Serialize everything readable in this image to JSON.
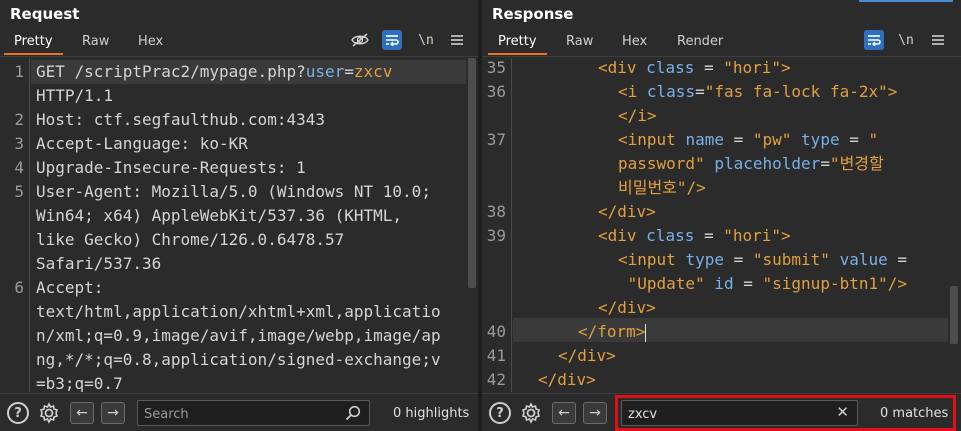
{
  "request": {
    "title": "Request",
    "tabs": [
      "Pretty",
      "Raw",
      "Hex"
    ],
    "active_tab": "Pretty",
    "toolbar_icons": [
      "eye-off-icon",
      "wrap-icon",
      "newline-icon",
      "menu-icon"
    ],
    "newline_label": "\\n",
    "lines": [
      {
        "num": "1",
        "parts": [
          [
            "txt",
            "GET /scriptPrac2/mypage.php?"
          ],
          [
            "param",
            "user"
          ],
          [
            "txt",
            "="
          ],
          [
            "pval",
            "zxcv"
          ]
        ]
      },
      {
        "num": "",
        "parts": [
          [
            "txt",
            "HTTP/1.1"
          ]
        ]
      },
      {
        "num": "2",
        "parts": [
          [
            "txt",
            "Host: ctf.segfaulthub.com:4343"
          ]
        ]
      },
      {
        "num": "3",
        "parts": [
          [
            "txt",
            "Accept-Language: ko-KR"
          ]
        ]
      },
      {
        "num": "4",
        "parts": [
          [
            "txt",
            "Upgrade-Insecure-Requests: 1"
          ]
        ]
      },
      {
        "num": "5",
        "parts": [
          [
            "txt",
            "User-Agent: Mozilla/5.0 (Windows NT 10.0;"
          ]
        ]
      },
      {
        "num": "",
        "parts": [
          [
            "txt",
            "Win64; x64) AppleWebKit/537.36 (KHTML,"
          ]
        ]
      },
      {
        "num": "",
        "parts": [
          [
            "txt",
            "like Gecko) Chrome/126.0.6478.57"
          ]
        ]
      },
      {
        "num": "",
        "parts": [
          [
            "txt",
            "Safari/537.36"
          ]
        ]
      },
      {
        "num": "6",
        "parts": [
          [
            "txt",
            "Accept:"
          ]
        ]
      },
      {
        "num": "",
        "parts": [
          [
            "txt",
            "text/html,application/xhtml+xml,applicatio"
          ]
        ]
      },
      {
        "num": "",
        "parts": [
          [
            "txt",
            "n/xml;q=0.9,image/avif,image/webp,image/ap"
          ]
        ]
      },
      {
        "num": "",
        "parts": [
          [
            "txt",
            "ng,*/*;q=0.8,application/signed-exchange;v"
          ]
        ]
      },
      {
        "num": "",
        "parts": [
          [
            "txt",
            "=b3;q=0.7"
          ]
        ]
      }
    ],
    "search": {
      "placeholder": "Search",
      "value": ""
    },
    "highlights_label": "0 highlights"
  },
  "response": {
    "title": "Response",
    "tabs": [
      "Pretty",
      "Raw",
      "Hex",
      "Render"
    ],
    "active_tab": "Pretty",
    "toolbar_icons": [
      "wrap-icon",
      "newline-icon",
      "menu-icon"
    ],
    "newline_label": "\\n",
    "lines": [
      {
        "num": "35",
        "indent": 4,
        "parts": [
          [
            "tag",
            "<div "
          ],
          [
            "attr",
            "class"
          ],
          [
            "txt",
            " = "
          ],
          [
            "val",
            "\"hori\""
          ],
          [
            "tag",
            ">"
          ]
        ]
      },
      {
        "num": "36",
        "indent": 5,
        "parts": [
          [
            "tag",
            "<i "
          ],
          [
            "attr",
            "class"
          ],
          [
            "txt",
            "="
          ],
          [
            "val",
            "\"fas fa-lock fa-2x\""
          ],
          [
            "tag",
            ">"
          ]
        ]
      },
      {
        "num": "",
        "indent": 5,
        "parts": [
          [
            "tag",
            "</i>"
          ]
        ]
      },
      {
        "num": "37",
        "indent": 5,
        "parts": [
          [
            "tag",
            "<input "
          ],
          [
            "attr",
            "name"
          ],
          [
            "txt",
            " = "
          ],
          [
            "val",
            "\"pw\""
          ],
          [
            "txt",
            " "
          ],
          [
            "attr",
            "type"
          ],
          [
            "txt",
            " = "
          ],
          [
            "val",
            "\""
          ]
        ]
      },
      {
        "num": "",
        "indent": 5,
        "parts": [
          [
            "val",
            "password\""
          ],
          [
            "txt",
            " "
          ],
          [
            "attr",
            "placeholder"
          ],
          [
            "txt",
            "="
          ],
          [
            "val",
            "\"변경할"
          ]
        ]
      },
      {
        "num": "",
        "indent": 5,
        "parts": [
          [
            "val",
            "비밀번호\""
          ],
          [
            "tag",
            "/>"
          ]
        ]
      },
      {
        "num": "38",
        "indent": 4,
        "parts": [
          [
            "tag",
            "</div>"
          ]
        ]
      },
      {
        "num": "39",
        "indent": 4,
        "parts": [
          [
            "tag",
            "<div "
          ],
          [
            "attr",
            "class"
          ],
          [
            "txt",
            " = "
          ],
          [
            "val",
            "\"hori\""
          ],
          [
            "tag",
            ">"
          ]
        ]
      },
      {
        "num": "",
        "indent": 5,
        "parts": [
          [
            "tag",
            "<input "
          ],
          [
            "attr",
            "type"
          ],
          [
            "txt",
            " = "
          ],
          [
            "val",
            "\"submit\""
          ],
          [
            "txt",
            " "
          ],
          [
            "attr",
            "value"
          ],
          [
            "txt",
            " ="
          ]
        ]
      },
      {
        "num": "",
        "indent": 5,
        "parts": [
          [
            "val",
            " \"Update\""
          ],
          [
            "txt",
            " "
          ],
          [
            "attr",
            "id"
          ],
          [
            "txt",
            " = "
          ],
          [
            "val",
            "\"signup-btn1\""
          ],
          [
            "tag",
            "/>"
          ]
        ]
      },
      {
        "num": "",
        "indent": 4,
        "parts": [
          [
            "tag",
            "</div>"
          ]
        ]
      },
      {
        "num": "40",
        "indent": 3,
        "parts": [
          [
            "tag",
            "</form>"
          ]
        ]
      },
      {
        "num": "41",
        "indent": 2,
        "parts": [
          [
            "tag",
            "</div>"
          ]
        ]
      },
      {
        "num": "42",
        "indent": 1,
        "parts": [
          [
            "tag",
            "</div>"
          ]
        ]
      }
    ],
    "search": {
      "placeholder": "Search",
      "value": "zxcv"
    },
    "matches_label": "0 matches"
  },
  "colors": {
    "accent_tab": "#e8702a",
    "toggle_blue": "#2e6fc0",
    "search_highlight_border": "#e0101a"
  }
}
